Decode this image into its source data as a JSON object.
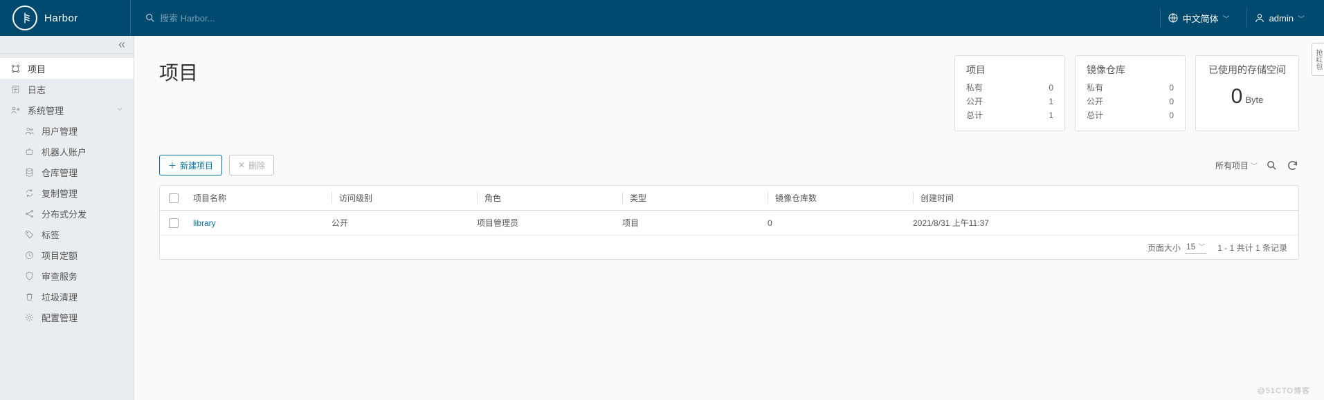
{
  "header": {
    "brand": "Harbor",
    "search_placeholder": "搜索 Harbor...",
    "lang_label": "中文简体",
    "user_label": "admin"
  },
  "sidebar": {
    "projects": "项目",
    "logs": "日志",
    "sys_admin": "系统管理",
    "user_mgmt": "用户管理",
    "robot_acct": "机器人账户",
    "registry": "仓库管理",
    "replication": "复制管理",
    "distribution": "分布式分发",
    "labels": "标签",
    "quota": "项目定额",
    "interrogation": "审查服务",
    "gc": "垃圾清理",
    "config": "配置管理"
  },
  "page": {
    "title": "项目"
  },
  "stats": {
    "projects": {
      "title": "项目",
      "private_label": "私有",
      "private_value": "0",
      "public_label": "公开",
      "public_value": "1",
      "total_label": "总计",
      "total_value": "1"
    },
    "repos": {
      "title": "镜像仓库",
      "private_label": "私有",
      "private_value": "0",
      "public_label": "公开",
      "public_value": "0",
      "total_label": "总计",
      "total_value": "0"
    },
    "storage": {
      "title": "已使用的存储空间",
      "value": "0",
      "unit": "Byte"
    }
  },
  "toolbar": {
    "new_project": "新建项目",
    "delete": "删除",
    "filter_all": "所有项目"
  },
  "table": {
    "headers": {
      "name": "项目名称",
      "access": "访问级别",
      "role": "角色",
      "type": "类型",
      "repo_count": "镜像仓库数",
      "created": "创建时间"
    },
    "rows": [
      {
        "name": "library",
        "access": "公开",
        "role": "项目管理员",
        "type": "项目",
        "repo_count": "0",
        "created": "2021/8/31 上午11:37"
      }
    ],
    "footer": {
      "page_size_label": "页面大小",
      "page_size_value": "15",
      "range": "1 - 1 共计 1 条记录"
    }
  },
  "misc": {
    "watermark": "@51CTO博客",
    "edge_tab": "抢红包"
  }
}
